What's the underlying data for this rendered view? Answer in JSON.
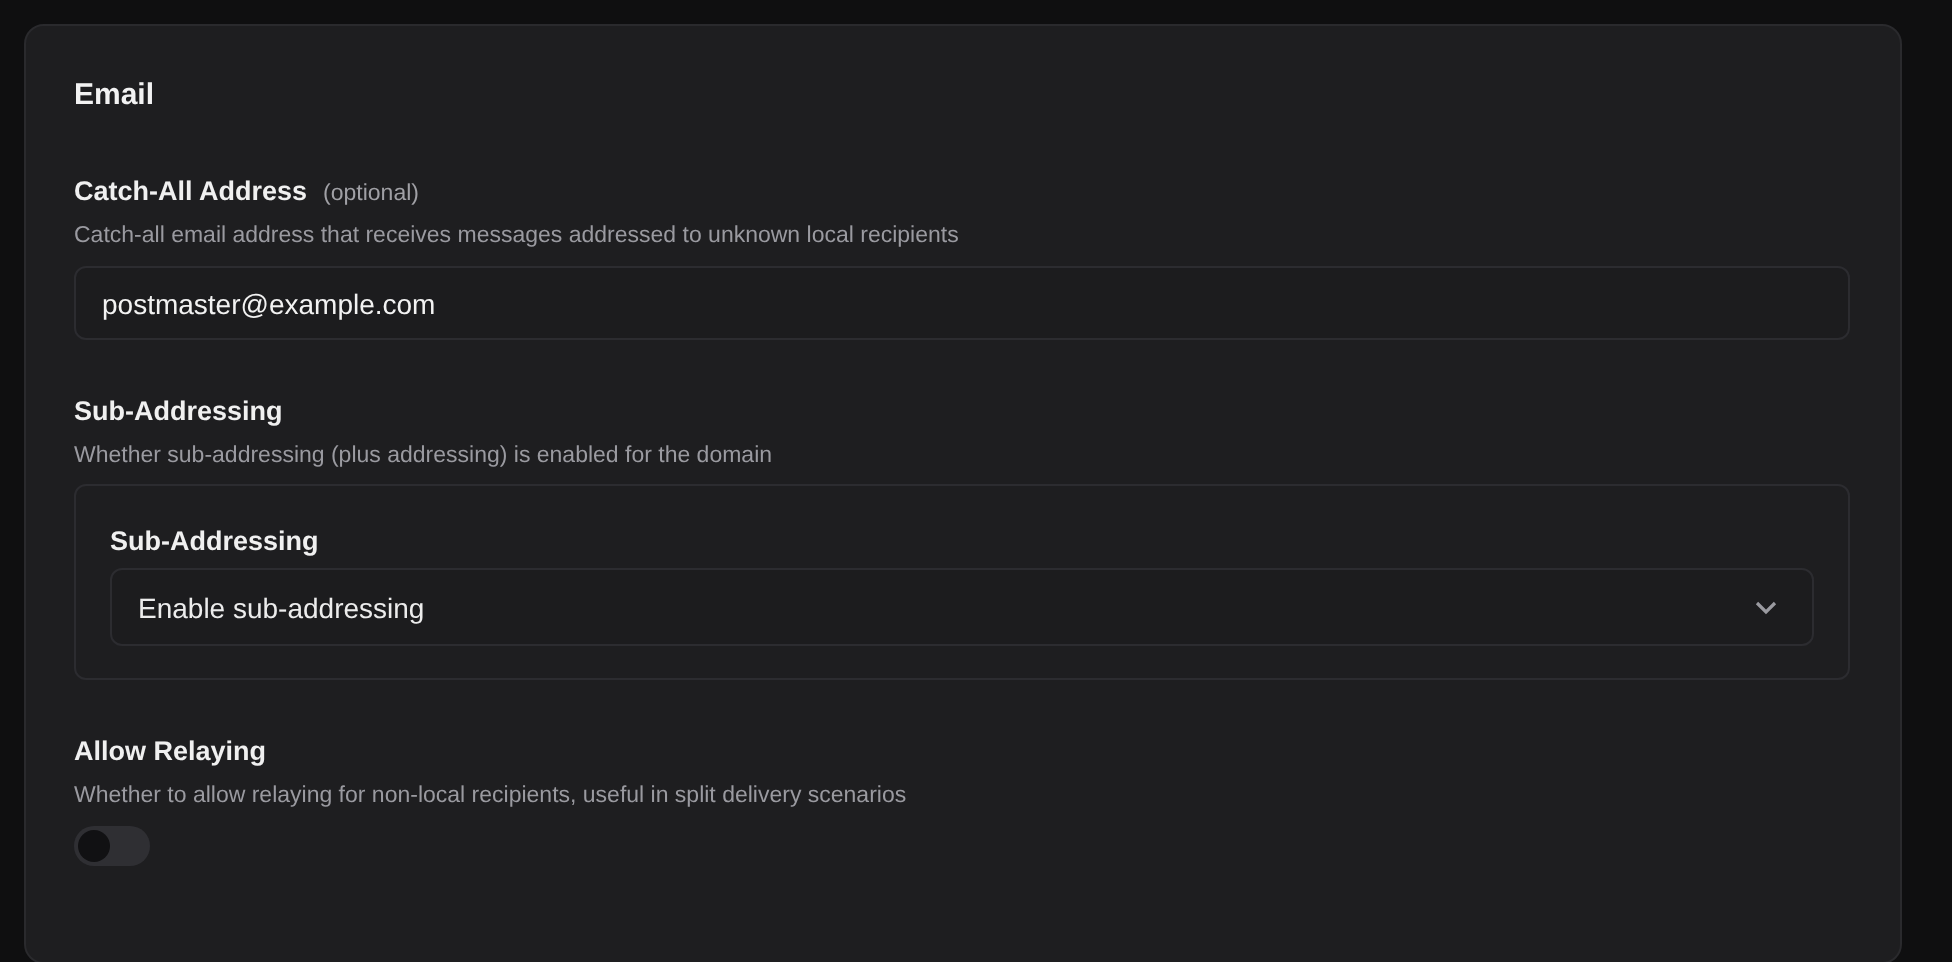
{
  "section": {
    "title": "Email"
  },
  "catch_all": {
    "label": "Catch-All Address",
    "optional": "(optional)",
    "description": "Catch-all email address that receives messages addressed to unknown local recipients",
    "value": "postmaster@example.com"
  },
  "sub_addressing": {
    "label": "Sub-Addressing",
    "description": "Whether sub-addressing (plus addressing) is enabled for the domain",
    "group_label": "Sub-Addressing",
    "select_value": "Enable sub-addressing"
  },
  "allow_relaying": {
    "label": "Allow Relaying",
    "description": "Whether to allow relaying for non-local recipients, useful in split delivery scenarios",
    "on": false
  }
}
